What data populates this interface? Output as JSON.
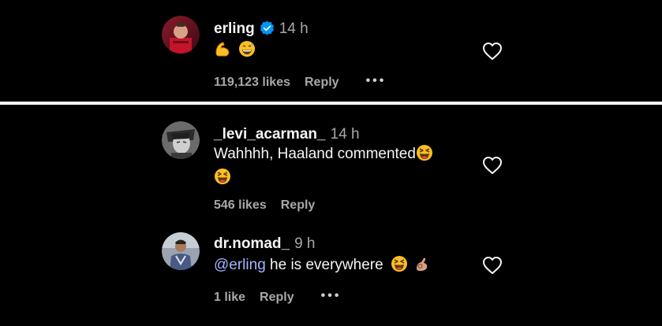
{
  "colors": {
    "background": "#000000",
    "text": "#f5f5f5",
    "secondary": "#a8a8a8",
    "mention": "#a5b6ff",
    "verified": "#0095f6",
    "divider": "#ffffff"
  },
  "comments": [
    {
      "username": "erling",
      "verified": true,
      "time": "14 h",
      "text": "",
      "emojis": [
        "flexed-biceps",
        "grinning-sweat-face"
      ],
      "likes": "119,123 likes",
      "reply": "Reply",
      "more": "•••"
    },
    {
      "username": "_levi_acarman_",
      "verified": false,
      "time": "14 h",
      "text": "Wahhhh, Haaland commented",
      "emojis": [
        "squinting-laughing-face",
        "squinting-laughing-face"
      ],
      "likes": "546 likes",
      "reply": "Reply"
    },
    {
      "username": "dr.nomad_",
      "verified": false,
      "time": "9 h",
      "mention": "@erling",
      "text": " he is everywhere",
      "emojis": [
        "squinting-laughing-face",
        "ok-hand"
      ],
      "likes": "1 like",
      "reply": "Reply",
      "more": "•••"
    }
  ],
  "icons": {
    "heart": "heart-outline-icon",
    "verified": "verified-badge-icon",
    "more": "more-options-icon"
  }
}
